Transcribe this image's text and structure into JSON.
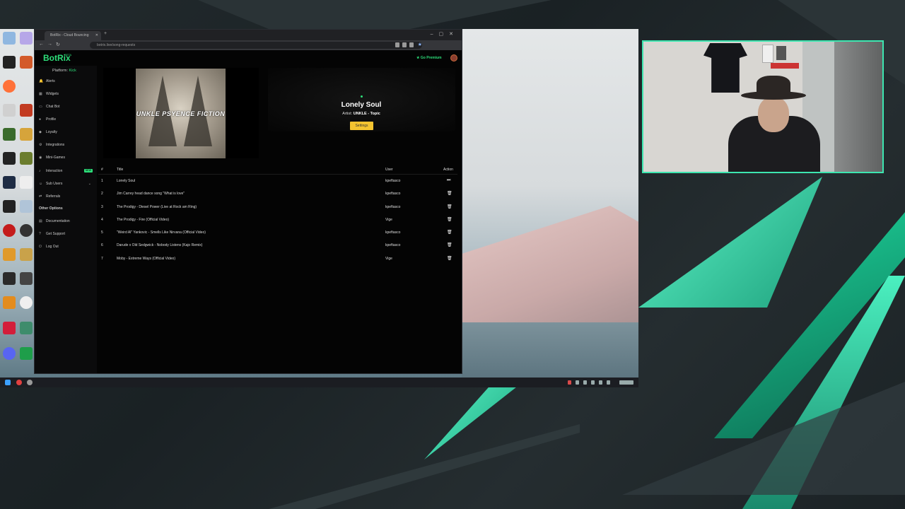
{
  "browser": {
    "tab_title": "BotRix - Cloud Bouncing",
    "url": "botrix.live/song-requests"
  },
  "app": {
    "logo": "BotRix",
    "beta": "BETA",
    "premium": "★ Go Premium",
    "platform_label": "Platform:",
    "platform_value": "Kick"
  },
  "sidebar": {
    "items": [
      {
        "label": "Alerts",
        "icon": "bell-icon"
      },
      {
        "label": "Widgets",
        "icon": "grid-icon"
      },
      {
        "label": "Chat Bot",
        "icon": "chat-icon"
      },
      {
        "label": "Profile",
        "icon": "user-icon"
      },
      {
        "label": "Loyalty",
        "icon": "coin-icon"
      },
      {
        "label": "Integrations",
        "icon": "plug-icon"
      },
      {
        "label": "Mini-Games",
        "icon": "gamepad-icon"
      },
      {
        "label": "Interaction",
        "icon": "music-icon",
        "badge": "NEW"
      },
      {
        "label": "Sub Users",
        "icon": "users-icon"
      },
      {
        "label": "Referrals",
        "icon": "referral-icon"
      }
    ],
    "other_options_label": "Other Options",
    "other": [
      {
        "label": "Documentation",
        "icon": "doc-icon"
      },
      {
        "label": "Get Support",
        "icon": "support-icon"
      },
      {
        "label": "Log Out",
        "icon": "logout-icon"
      }
    ]
  },
  "now_playing": {
    "cover_text": "UNKLE PSYENCE FICTION",
    "title": "Lonely Soul",
    "artist_label": "Artist:",
    "artist": "UNKLE - Topic",
    "settings_label": "Settings"
  },
  "queue": {
    "headers": {
      "num": "#",
      "title": "Title",
      "user": "User",
      "action": "Action"
    },
    "rows": [
      {
        "num": "1",
        "title": "Lonely Soul",
        "user": "kpeftasco",
        "action": "⏭"
      },
      {
        "num": "2",
        "title": "Jim Carrey head dance song \"What is love\"",
        "user": "kpeftasco",
        "action": "🗑"
      },
      {
        "num": "3",
        "title": "The Prodigy - Diesel Power (Live at Rock am Ring)",
        "user": "kpeftasco",
        "action": "🗑"
      },
      {
        "num": "4",
        "title": "The Prodigy - Fire (Official Video)",
        "user": "Vige",
        "action": "🗑"
      },
      {
        "num": "5",
        "title": "\"Weird Al\" Yankovic - Smells Like Nirvana (Official Video)",
        "user": "kpeftasco",
        "action": "🗑"
      },
      {
        "num": "6",
        "title": "Darude x Old Sedgwick - Nobody Listens (Kajo Remix)",
        "user": "kpeftasco",
        "action": "🗑"
      },
      {
        "num": "7",
        "title": "Moby - Extreme Ways (Official Video)",
        "user": "Vige",
        "action": "🗑"
      }
    ]
  },
  "colors": {
    "accent": "#2ddf7a",
    "settings_button": "#f4c430",
    "cam_border": "#3de6b0"
  }
}
